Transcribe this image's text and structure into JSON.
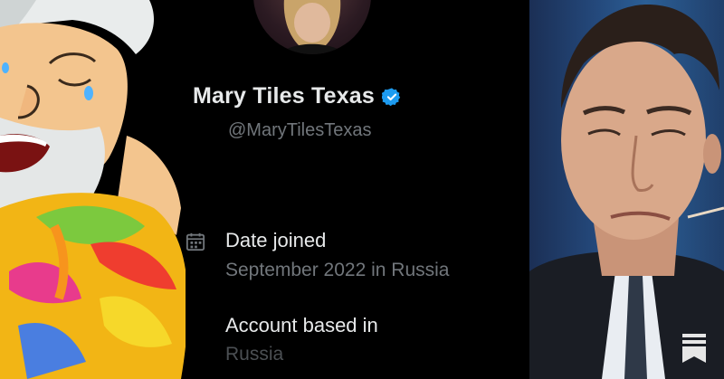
{
  "profile": {
    "display_name": "Mary Tiles Texas",
    "handle": "@MaryTilesTexas",
    "verified_icon": "verified-badge-icon",
    "verified_color": "#1d9bf0"
  },
  "details": {
    "date_joined_label": "Date joined",
    "date_joined_value": "September 2022 in Russia",
    "account_based_label": "Account based in",
    "account_based_value": "Russia",
    "calendar_icon": "calendar-icon"
  },
  "colors": {
    "background": "#000000",
    "primary_text": "#e7e9ea",
    "secondary_text": "#71767b"
  },
  "icons": {
    "bottom_right": "substack-logo-icon"
  }
}
